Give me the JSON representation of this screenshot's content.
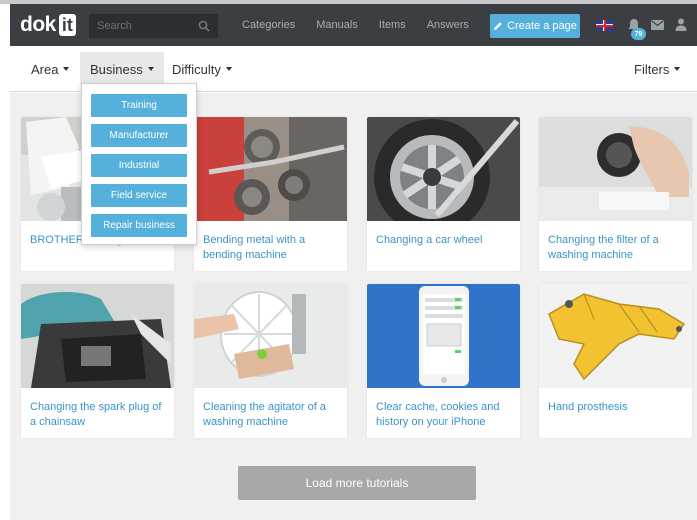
{
  "brand": {
    "logo_left": "dok",
    "logo_right": "it"
  },
  "search": {
    "placeholder": "Search"
  },
  "nav": {
    "links": [
      "Categories",
      "Manuals",
      "Items",
      "Answers"
    ]
  },
  "create_button": {
    "label": "Create a page"
  },
  "notifications": {
    "count": "79"
  },
  "filters": {
    "area": "Area",
    "business": "Business",
    "difficulty": "Difficulty",
    "right": "Filters"
  },
  "business_dropdown": {
    "options": [
      "Training",
      "Manufacturer",
      "Industrial",
      "Field service",
      "Repair business"
    ]
  },
  "tutorials": [
    {
      "title": "BROTHER Sewing machine"
    },
    {
      "title": "Bending metal with a bending machine"
    },
    {
      "title": "Changing a car wheel"
    },
    {
      "title": "Changing the filter of a washing machine"
    },
    {
      "title": "Changing the spark plug of a chainsaw"
    },
    {
      "title": "Cleaning the agitator of a washing machine"
    },
    {
      "title": "Clear cache, cookies and history on your iPhone"
    },
    {
      "title": "Hand prosthesis"
    }
  ],
  "load_more": {
    "label": "Load more tutorials"
  },
  "colors": {
    "navbar": "#3b3f44",
    "accent": "#55b0dc",
    "link": "#3a94c8",
    "page_bg": "#f0f0f0",
    "load_more_bg": "#a8a8a8"
  }
}
